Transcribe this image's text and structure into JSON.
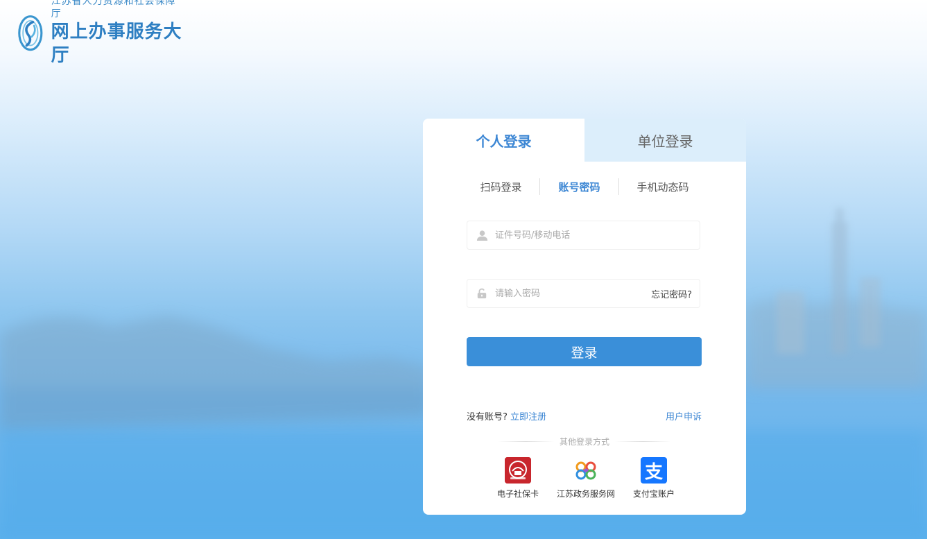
{
  "header": {
    "org_name": "江苏省人力资源和社会保障厅",
    "portal_name": "网上办事服务大厅"
  },
  "login": {
    "tabs": [
      {
        "label": "个人登录",
        "active": true
      },
      {
        "label": "单位登录",
        "active": false
      }
    ],
    "methods": [
      {
        "label": "扫码登录",
        "active": false
      },
      {
        "label": "账号密码",
        "active": true
      },
      {
        "label": "手机动态码",
        "active": false
      }
    ],
    "id_field": {
      "placeholder": "证件号码/移动电话",
      "value": ""
    },
    "password_field": {
      "placeholder": "请输入密码",
      "value": ""
    },
    "forgot_password": "忘记密码?",
    "submit_label": "登录",
    "no_account": "没有账号?",
    "register_link": "立即注册",
    "complaint_link": "用户申诉",
    "other_methods_label": "其他登录方式",
    "alt_logins": [
      {
        "label": "电子社保卡",
        "icon": "social-security-card-icon"
      },
      {
        "label": "江苏政务服务网",
        "icon": "jiangsu-gov-service-icon"
      },
      {
        "label": "支付宝账户",
        "icon": "alipay-icon",
        "glyph": "支"
      }
    ]
  },
  "colors": {
    "accent": "#3d87d4",
    "button": "#3a8fd9",
    "inactive_tab_bg": "#dceefb",
    "social_card_red": "#c8262d",
    "alipay_blue": "#1677ff"
  }
}
